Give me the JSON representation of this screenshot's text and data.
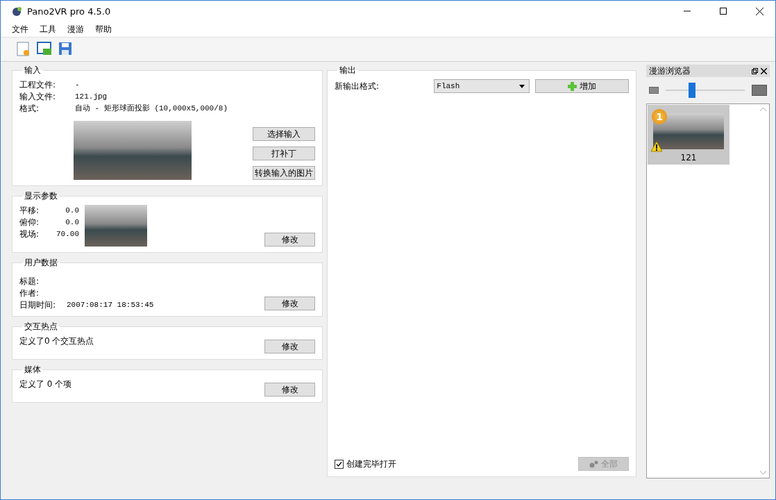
{
  "window": {
    "title": "Pano2VR pro 4.5.0"
  },
  "menu": [
    "文件",
    "工具",
    "漫游",
    "帮助"
  ],
  "input": {
    "title": "输入",
    "fields": [
      {
        "label": "工程文件:",
        "value": "-"
      },
      {
        "label": "输入文件:",
        "value": "121.jpg"
      },
      {
        "label": "格式:",
        "value": "自动 - 矩形球面投影 (10,000x5,000/8)"
      }
    ],
    "buttons": [
      "选择输入",
      "打补丁",
      "转换输入的图片"
    ]
  },
  "display": {
    "title": "显示参数",
    "fields": [
      {
        "label": "平移:",
        "value": "0.0"
      },
      {
        "label": "俯仰:",
        "value": "0.0"
      },
      {
        "label": "视场:",
        "value": "70.00"
      }
    ],
    "button": "修改"
  },
  "user_data": {
    "title": "用户数据",
    "fields": [
      {
        "label": "标题:"
      },
      {
        "label": "作者:"
      },
      {
        "label": "日期时间:",
        "value": "2007:08:17 18:53:45"
      }
    ],
    "button": "修改"
  },
  "hotspots": {
    "title": "交互热点",
    "summary": "定义了0 个交互热点",
    "button": "修改"
  },
  "media": {
    "title": "媒体",
    "summary": "定义了 0 个项",
    "button": "修改"
  },
  "output": {
    "title": "输出",
    "format_label": "新输出格式:",
    "format_value": "Flash",
    "add_button": "增加",
    "open_after_build": {
      "label": "创建完毕打开",
      "checked": true
    },
    "build_all": {
      "label": "全部",
      "disabled": true
    }
  },
  "tour_browser": {
    "title": "漫游浏览器",
    "zoom": {
      "level": 0.33
    },
    "items": [
      {
        "label": "121",
        "badge": "1",
        "selected": true,
        "warning": true
      }
    ]
  }
}
